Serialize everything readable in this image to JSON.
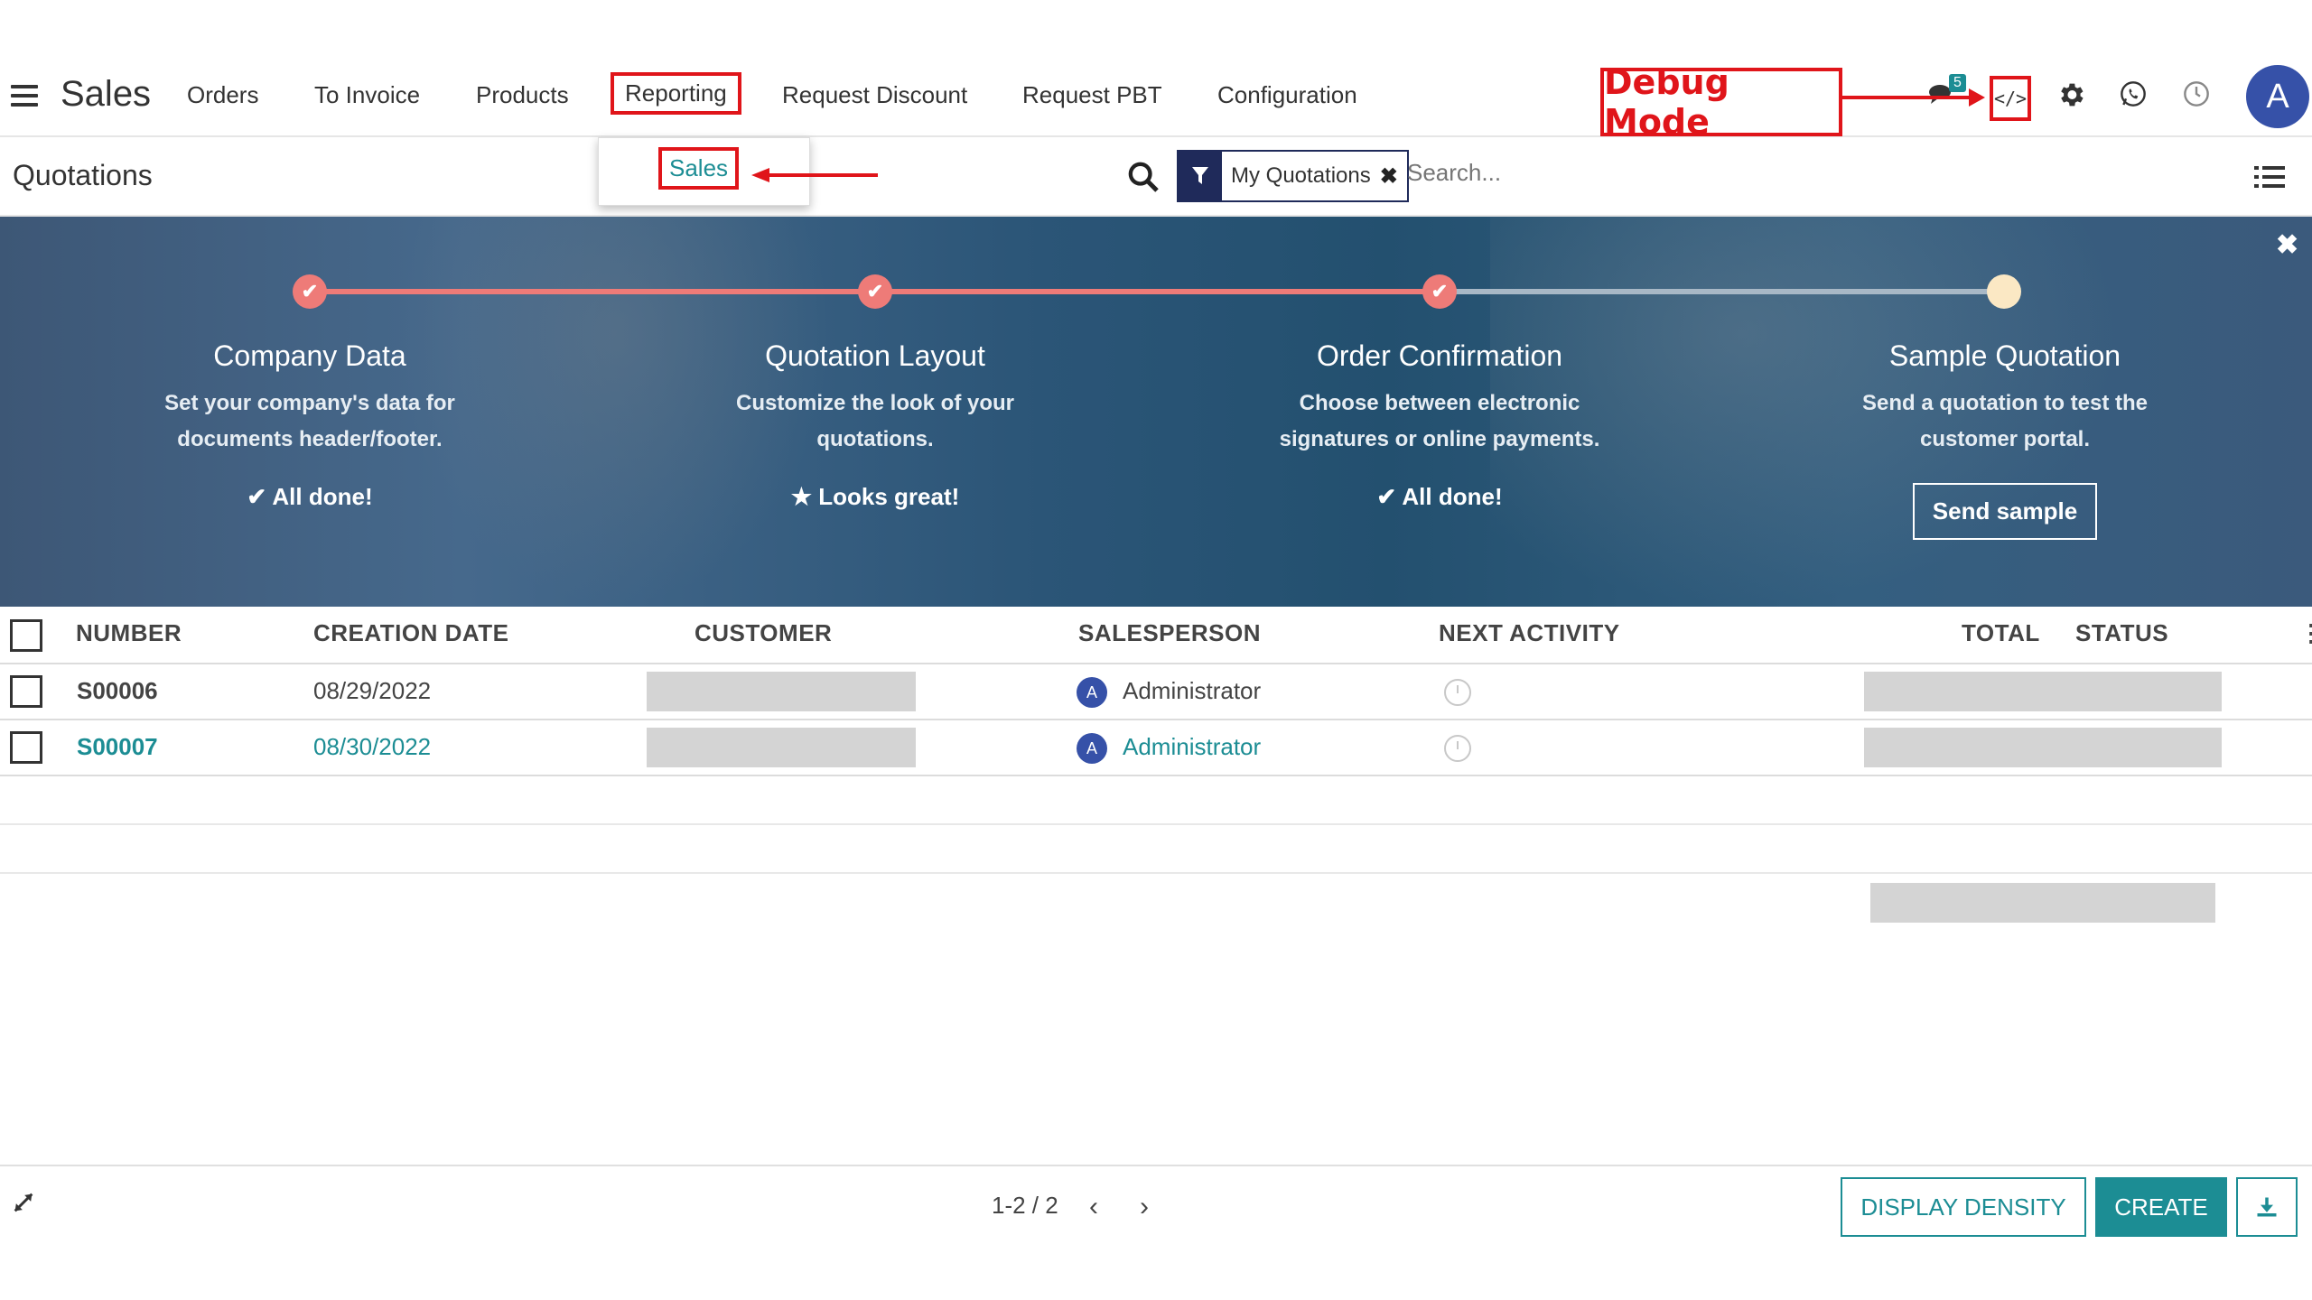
{
  "app": {
    "title": "Sales"
  },
  "menu": [
    {
      "label": "Orders"
    },
    {
      "label": "To Invoice"
    },
    {
      "label": "Products"
    },
    {
      "label": "Reporting"
    },
    {
      "label": "Request Discount"
    },
    {
      "label": "Request PBT"
    },
    {
      "label": "Configuration"
    }
  ],
  "reporting_dropdown": {
    "item": "Sales"
  },
  "annotation": {
    "debug_label": "Debug Mode"
  },
  "systray": {
    "message_badge": "5",
    "debug_icon_text": "</>",
    "avatar_letter": "A"
  },
  "control_panel": {
    "breadcrumb": "Quotations",
    "facet": "My Quotations",
    "search_placeholder": "Search..."
  },
  "onboarding": {
    "steps": [
      {
        "title": "Company Data",
        "desc1": "Set your company's data for",
        "desc2": "documents header/footer.",
        "status": "All done!",
        "status_icon": "check"
      },
      {
        "title": "Quotation Layout",
        "desc1": "Customize the look of your",
        "desc2": "quotations.",
        "status": "Looks great!",
        "status_icon": "star"
      },
      {
        "title": "Order Confirmation",
        "desc1": "Choose between electronic",
        "desc2": "signatures or online payments.",
        "status": "All done!",
        "status_icon": "check"
      },
      {
        "title": "Sample Quotation",
        "desc1": "Send a quotation to test the",
        "desc2": "customer portal.",
        "button": "Send sample"
      }
    ]
  },
  "table": {
    "headers": {
      "number": "NUMBER",
      "creation_date": "CREATION DATE",
      "customer": "CUSTOMER",
      "salesperson": "SALESPERSON",
      "next_activity": "NEXT ACTIVITY",
      "total": "TOTAL",
      "status": "STATUS"
    },
    "rows": [
      {
        "number": "S00006",
        "date": "08/29/2022",
        "salesperson": "Administrator",
        "avatar": "A"
      },
      {
        "number": "S00007",
        "date": "08/30/2022",
        "salesperson": "Administrator",
        "avatar": "A"
      }
    ]
  },
  "footer": {
    "pager": "1-2 / 2",
    "display_density": "DISPLAY DENSITY",
    "create": "CREATE"
  },
  "colors": {
    "accent": "#1c8d94",
    "annotation_red": "#e0151a",
    "avatar": "#3651a8",
    "facet": "#1f2a5a"
  }
}
